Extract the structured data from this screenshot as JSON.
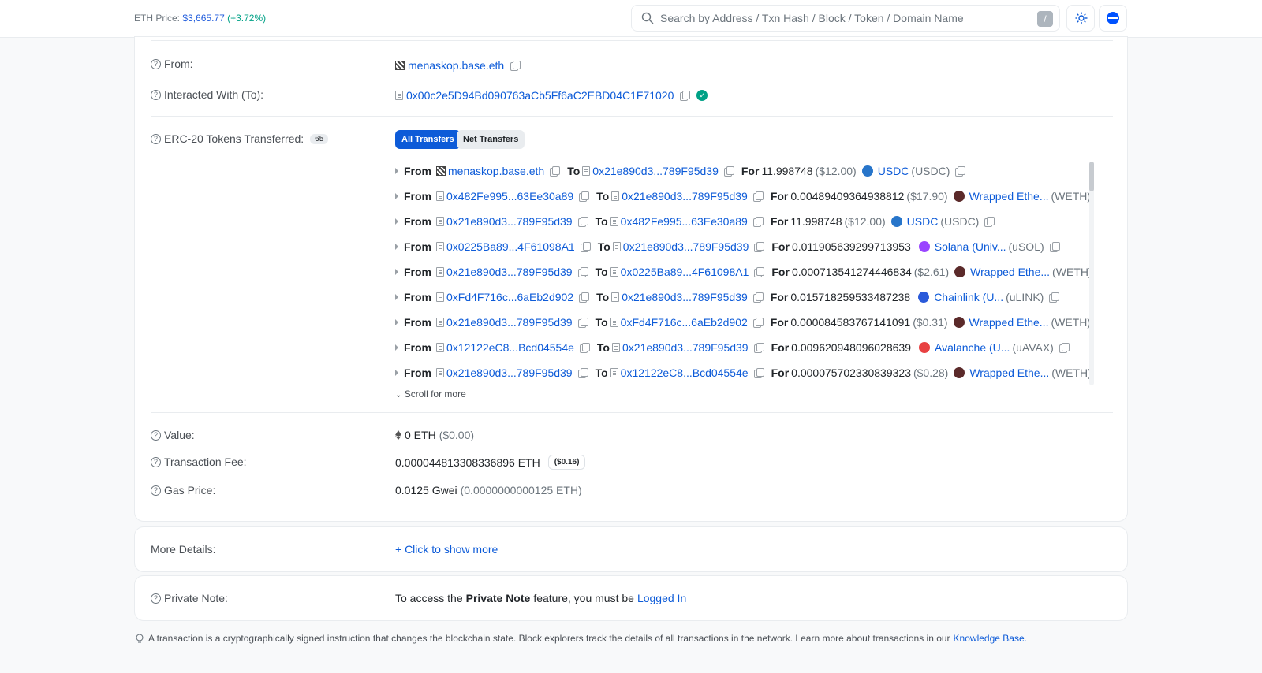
{
  "topbar": {
    "eth_price_label": "ETH Price:",
    "eth_price_value": "$3,665.77",
    "eth_price_change": "(+3.72%)",
    "search_placeholder": "Search by Address / Txn Hash / Block / Token / Domain Name",
    "search_shortcut": "/"
  },
  "main": {
    "from_label": "From:",
    "from_value": "menaskop.base.eth",
    "to_label": "Interacted With (To):",
    "to_value": "0x00c2e5D94Bd090763aCb5Ff6aC2EBD04C1F71020",
    "tokens_label": "ERC-20 Tokens Transferred:",
    "tokens_count": "65",
    "tab_all": "All Transfers",
    "tab_net": "Net Transfers",
    "transfers": [
      {
        "from": "menaskop.base.eth",
        "to": "0x21e890d3...789F95d39",
        "amount": "11.998748",
        "usd": "($12.00)",
        "token": "USDC",
        "symbol": "(USDC)",
        "icon_color": "#2775ca"
      },
      {
        "from": "0x482Fe995...63Ee30a89",
        "to": "0x21e890d3...789F95d39",
        "amount": "0.00489409364938812",
        "usd": "($17.90)",
        "token": "Wrapped Ethe...",
        "symbol": "(WETH)",
        "icon_color": "#5b2a2a"
      },
      {
        "from": "0x21e890d3...789F95d39",
        "to": "0x482Fe995...63Ee30a89",
        "amount": "11.998748",
        "usd": "($12.00)",
        "token": "USDC",
        "symbol": "(USDC)",
        "icon_color": "#2775ca"
      },
      {
        "from": "0x0225Ba89...4F61098A1",
        "to": "0x21e890d3...789F95d39",
        "amount": "0.011905639299713953",
        "usd": "",
        "token": "Solana (Univ...",
        "symbol": "(uSOL)",
        "icon_color": "#9945ff"
      },
      {
        "from": "0x21e890d3...789F95d39",
        "to": "0x0225Ba89...4F61098A1",
        "amount": "0.000713541274446834",
        "usd": "($2.61)",
        "token": "Wrapped Ethe...",
        "symbol": "(WETH)",
        "icon_color": "#5b2a2a"
      },
      {
        "from": "0xFd4F716c...6aEb2d902",
        "to": "0x21e890d3...789F95d39",
        "amount": "0.015718259533487238",
        "usd": "",
        "token": "Chainlink (U...",
        "symbol": "(uLINK)",
        "icon_color": "#2a5ada"
      },
      {
        "from": "0x21e890d3...789F95d39",
        "to": "0xFd4F716c...6aEb2d902",
        "amount": "0.000084583767141091",
        "usd": "($0.31)",
        "token": "Wrapped Ethe...",
        "symbol": "(WETH)",
        "icon_color": "#5b2a2a"
      },
      {
        "from": "0x12122eC8...Bcd04554e",
        "to": "0x21e890d3...789F95d39",
        "amount": "0.009620948096028639",
        "usd": "",
        "token": "Avalanche (U...",
        "symbol": "(uAVAX)",
        "icon_color": "#e84142"
      },
      {
        "from": "0x21e890d3...789F95d39",
        "to": "0x12122eC8...Bcd04554e",
        "amount": "0.000075702330839323",
        "usd": "($0.28)",
        "token": "Wrapped Ethe...",
        "symbol": "(WETH)",
        "icon_color": "#5b2a2a"
      }
    ],
    "word_from": "From",
    "word_to": "To",
    "word_for": "For",
    "scroll_more": "Scroll for more",
    "value_label": "Value:",
    "value_eth": "0 ETH",
    "value_usd": "($0.00)",
    "fee_label": "Transaction Fee:",
    "fee_value": "0.000044813308336896 ETH",
    "fee_usd": "($0.16)",
    "gas_label": "Gas Price:",
    "gas_value": "0.0125 Gwei",
    "gas_eth": "(0.0000000000125 ETH)"
  },
  "details": {
    "label": "More Details:",
    "link": "+ Click to show more"
  },
  "note": {
    "label": "Private Note:",
    "text_a": "To access the",
    "text_b": "Private Note",
    "text_c": "feature, you must be",
    "login": "Logged In"
  },
  "footer": {
    "text": "A transaction is a cryptographically signed instruction that changes the blockchain state. Block explorers track the details of all transactions in the network. Learn more about transactions in our",
    "link": "Knowledge Base."
  }
}
